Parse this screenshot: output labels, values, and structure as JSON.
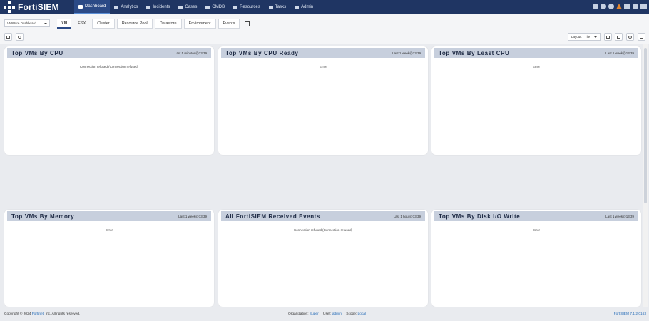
{
  "app": {
    "brand": "FortiSIEM"
  },
  "nav": {
    "items": [
      {
        "label": "Dashboard",
        "icon": "dashboard-icon",
        "active": true
      },
      {
        "label": "Analytics",
        "icon": "analytics-icon"
      },
      {
        "label": "Incidents",
        "icon": "bell-icon"
      },
      {
        "label": "Cases",
        "icon": "briefcase-icon"
      },
      {
        "label": "CMDB",
        "icon": "database-icon"
      },
      {
        "label": "Resources",
        "icon": "folder-icon"
      },
      {
        "label": "Tasks",
        "icon": "list-icon"
      },
      {
        "label": "Admin",
        "icon": "gear-icon"
      }
    ],
    "tray_icons": [
      "chat-icon",
      "gamepad-icon",
      "help-icon",
      "warning-icon",
      "screen-icon",
      "user-icon",
      "logout-icon"
    ]
  },
  "toolbar": {
    "dashboard_select": "VMWare Dashboard",
    "tabs": [
      "VM",
      "ESX",
      "Cluster",
      "Resource Pool",
      "Datastore",
      "Environment",
      "Events"
    ],
    "layout_label": "Layout:",
    "layout_value": "Tile"
  },
  "widgets": [
    {
      "title": "Top VMs By CPU",
      "range": "Last 5 minutes@13:39",
      "message": "Connection refused (Connection refused)"
    },
    {
      "title": "Top VMs By CPU Ready",
      "range": "Last 1 week@13:39",
      "message": "Error"
    },
    {
      "title": "Top VMs By Least CPU",
      "range": "Last 1 week@13:39",
      "message": "Error"
    },
    {
      "title": "Top VMs By Memory",
      "range": "Last 1 week@13:39",
      "message": "Error"
    },
    {
      "title": "All FortiSIEM Received Events",
      "range": "Last 1 hour@13:39",
      "message": "Connection refused (Connection refused)"
    },
    {
      "title": "Top VMs By Disk I/O Write",
      "range": "Last 1 week@13:39",
      "message": "Error"
    }
  ],
  "footer": {
    "copyright_pre": "Copyright © 2024",
    "copyright_link": "Fortinet",
    "copyright_post": ", Inc. All rights reserved.",
    "org_label": "Organization:",
    "org_value": "Super",
    "user_label": "User:",
    "user_value": "admin",
    "scope_label": "Scope:",
    "scope_value": "Local",
    "version": "FortiSIEM 7.1.2.0163"
  },
  "colors": {
    "nav_bg": "#1f3563",
    "header_bg": "#c7cfdd",
    "link": "#2b6fb9"
  }
}
